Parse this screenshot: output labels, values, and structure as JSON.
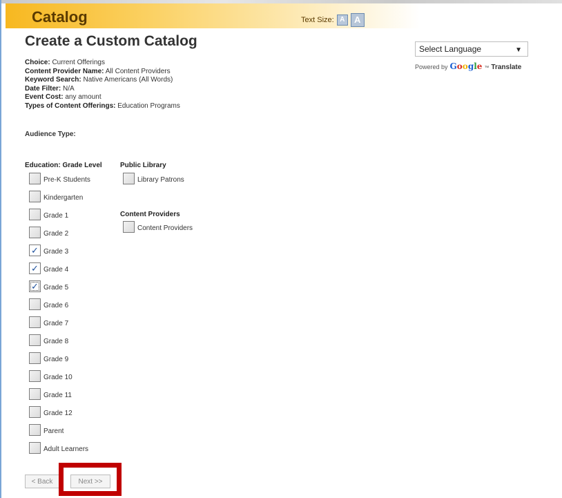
{
  "header": {
    "title": "Catalog",
    "text_size_label": "Text Size:",
    "small_a": "A",
    "large_a": "A"
  },
  "page": {
    "title": "Create a Custom Catalog"
  },
  "summary": [
    {
      "label": "Choice:",
      "value": "Current Offerings"
    },
    {
      "label": "Content Provider Name:",
      "value": "All Content Providers"
    },
    {
      "label": "Keyword Search:",
      "value": "Native Americans (All Words)"
    },
    {
      "label": "Date Filter:",
      "value": "N/A"
    },
    {
      "label": "Event Cost:",
      "value": "any amount"
    },
    {
      "label": "Types of Content Offerings:",
      "value": "Education Programs"
    }
  ],
  "audience_type_label": "Audience Type:",
  "education": {
    "heading": "Education: Grade Level",
    "items": [
      {
        "label": "Pre-K Students",
        "checked": false
      },
      {
        "label": "Kindergarten",
        "checked": false
      },
      {
        "label": "Grade 1",
        "checked": false
      },
      {
        "label": "Grade 2",
        "checked": false
      },
      {
        "label": "Grade 3",
        "checked": true
      },
      {
        "label": "Grade 4",
        "checked": true
      },
      {
        "label": "Grade 5",
        "checked": true
      },
      {
        "label": "Grade 6",
        "checked": false
      },
      {
        "label": "Grade 7",
        "checked": false
      },
      {
        "label": "Grade 8",
        "checked": false
      },
      {
        "label": "Grade 9",
        "checked": false
      },
      {
        "label": "Grade 10",
        "checked": false
      },
      {
        "label": "Grade 11",
        "checked": false
      },
      {
        "label": "Grade 12",
        "checked": false
      },
      {
        "label": "Parent",
        "checked": false
      },
      {
        "label": "Adult Learners",
        "checked": false
      }
    ]
  },
  "public_library": {
    "heading": "Public Library",
    "items": [
      {
        "label": "Library Patrons",
        "checked": false
      }
    ]
  },
  "content_providers": {
    "heading": "Content Providers",
    "items": [
      {
        "label": "Content Providers",
        "checked": false
      }
    ]
  },
  "buttons": {
    "back": "< Back",
    "next": "Next >>"
  },
  "language": {
    "selected": "Select Language",
    "powered_by": "Powered by",
    "google": "Google",
    "tm": "™",
    "translate": "Translate"
  },
  "colors": {
    "highlight": "#c00000",
    "header_orange": "#f7b820",
    "check": "#1c4f9c"
  }
}
